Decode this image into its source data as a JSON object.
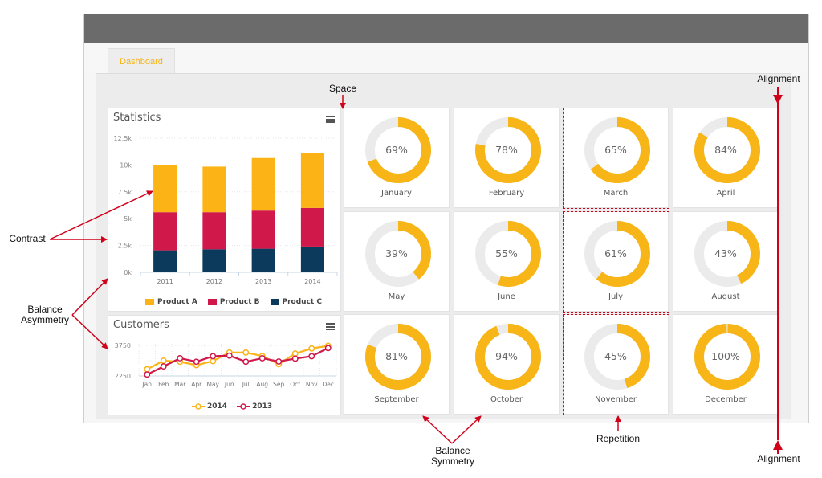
{
  "tabs": [
    {
      "label": "Dashboard",
      "active": true
    }
  ],
  "colors": {
    "accent": "#f7b517",
    "product_a": "#fbb316",
    "product_b": "#d0184a",
    "product_c": "#0b3a5c",
    "series_2014": "#fbb316",
    "series_2013": "#d0184a",
    "donut_track": "#ebebeb",
    "annotation": "#d0021b"
  },
  "statistics": {
    "title": "Statistics",
    "menu_icon": "hamburger-menu-icon",
    "legend": [
      "Product A",
      "Product B",
      "Product C"
    ]
  },
  "customers": {
    "title": "Customers",
    "menu_icon": "hamburger-menu-icon",
    "legend": [
      "2014",
      "2013"
    ]
  },
  "months": [
    {
      "name": "January",
      "percent": 69,
      "label": "69%"
    },
    {
      "name": "February",
      "percent": 78,
      "label": "78%"
    },
    {
      "name": "March",
      "percent": 65,
      "label": "65%"
    },
    {
      "name": "April",
      "percent": 84,
      "label": "84%"
    },
    {
      "name": "May",
      "percent": 39,
      "label": "39%"
    },
    {
      "name": "June",
      "percent": 55,
      "label": "55%"
    },
    {
      "name": "July",
      "percent": 61,
      "label": "61%"
    },
    {
      "name": "August",
      "percent": 43,
      "label": "43%"
    },
    {
      "name": "September",
      "percent": 81,
      "label": "81%"
    },
    {
      "name": "October",
      "percent": 94,
      "label": "94%"
    },
    {
      "name": "November",
      "percent": 45,
      "label": "45%"
    },
    {
      "name": "December",
      "percent": 100,
      "label": "100%"
    }
  ],
  "annotations": {
    "space": "Space",
    "alignment_top": "Alignment",
    "alignment_bottom": "Alignment",
    "contrast": "Contrast",
    "balance_asymmetry": [
      "Balance",
      "Asymmetry"
    ],
    "balance_symmetry": [
      "Balance",
      "Symmetry"
    ],
    "repetition": "Repetition"
  },
  "chart_data": [
    {
      "type": "bar",
      "stacked": true,
      "title": "Statistics",
      "categories": [
        "2011",
        "2012",
        "2013",
        "2014"
      ],
      "series": [
        {
          "name": "Product C",
          "values": [
            2050,
            2150,
            2200,
            2400
          ]
        },
        {
          "name": "Product B",
          "values": [
            3550,
            3450,
            3550,
            3600
          ]
        },
        {
          "name": "Product A",
          "values": [
            4400,
            4250,
            4900,
            5150
          ]
        }
      ],
      "ylim": [
        0,
        12500
      ],
      "yticks": [
        "0k",
        "2.5k",
        "5k",
        "7.5k",
        "10k",
        "12.5k"
      ],
      "ytick_values": [
        0,
        2500,
        5000,
        7500,
        10000,
        12500
      ],
      "xlabel": "",
      "ylabel": "",
      "grid": true,
      "legend": "bottom"
    },
    {
      "type": "line",
      "title": "Customers",
      "categories": [
        "Jan",
        "Feb",
        "Mar",
        "Apr",
        "May",
        "Jun",
        "Jul",
        "Aug",
        "Sep",
        "Oct",
        "Nov",
        "Dec"
      ],
      "series": [
        {
          "name": "2014",
          "values": [
            2580,
            3000,
            2950,
            2780,
            2980,
            3400,
            3400,
            3230,
            2830,
            3350,
            3600,
            3730
          ]
        },
        {
          "name": "2013",
          "values": [
            2320,
            2720,
            3120,
            2950,
            3220,
            3250,
            2950,
            3120,
            2960,
            3100,
            3220,
            3620
          ]
        }
      ],
      "ylim": [
        2250,
        3750
      ],
      "yticks": [
        "2250",
        "3750"
      ],
      "ytick_values": [
        2250,
        3750
      ],
      "xlabel": "",
      "ylabel": "",
      "grid": true,
      "legend": "bottom"
    }
  ]
}
